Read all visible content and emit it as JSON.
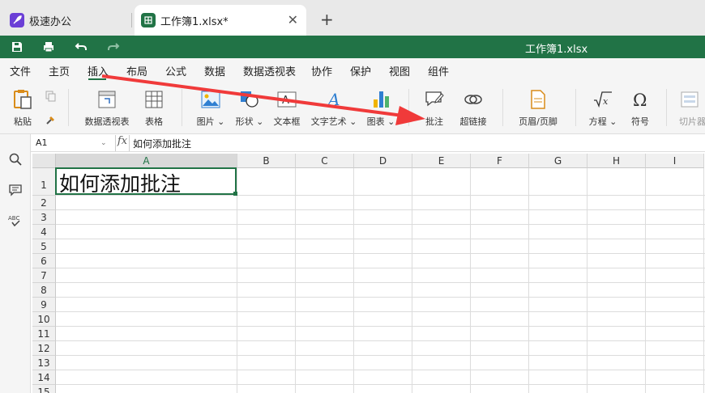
{
  "tabs": [
    {
      "label": "极速办公",
      "icon": "rocket-icon",
      "color": "#6b3fd6"
    },
    {
      "label": "工作簿1.xlsx*",
      "icon": "spreadsheet-icon",
      "color": "#217346"
    }
  ],
  "new_tab_symbol": "+",
  "close_symbol": "✕",
  "title": "工作簿1.xlsx",
  "menu": [
    "文件",
    "主页",
    "插入",
    "布局",
    "公式",
    "数据",
    "数据透视表",
    "协作",
    "保护",
    "视图",
    "组件"
  ],
  "menu_active": "插入",
  "ribbon": {
    "paste": "粘贴",
    "pivot_table": "数据透视表",
    "table": "表格",
    "picture": "图片",
    "shape": "形状",
    "textbox": "文本框",
    "wordart": "文字艺术",
    "chart": "图表",
    "comment": "批注",
    "hyperlink": "超链接",
    "header_footer": "页眉/页脚",
    "equation": "方程",
    "symbol": "符号",
    "slicer": "切片器"
  },
  "formula_bar": {
    "cell_ref": "A1",
    "fx_label": "fx",
    "value": "如何添加批注"
  },
  "columns": [
    "A",
    "B",
    "C",
    "D",
    "E",
    "F",
    "G",
    "H",
    "I"
  ],
  "rows": [
    "1",
    "2",
    "3",
    "4",
    "5",
    "6",
    "7",
    "8",
    "9",
    "10",
    "11",
    "12",
    "13",
    "14",
    "15"
  ],
  "cell_a1": "如何添加批注",
  "accent_color": "#217346",
  "annotation_arrow_color": "#f03a3a"
}
